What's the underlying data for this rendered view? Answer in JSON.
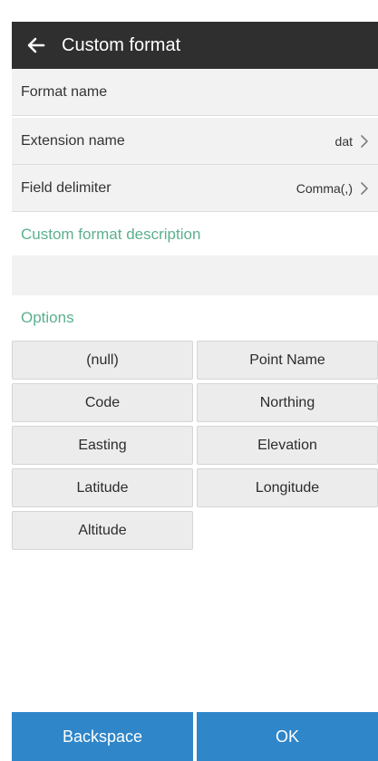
{
  "header": {
    "title": "Custom format"
  },
  "rows": [
    {
      "label": "Format name",
      "value": ""
    },
    {
      "label": "Extension name",
      "value": "dat"
    },
    {
      "label": "Field delimiter",
      "value": "Comma(,)"
    }
  ],
  "sections": {
    "description_title": "Custom format description",
    "options_title": "Options"
  },
  "options": [
    "(null)",
    "Point Name",
    "Code",
    "Northing",
    "Easting",
    "Elevation",
    "Latitude",
    "Longitude",
    "Altitude"
  ],
  "buttons": {
    "backspace": "Backspace",
    "ok": "OK"
  },
  "colors": {
    "header_bg": "#2f2f2f",
    "accent_green": "#5bb08e",
    "button_blue": "#2f86c9",
    "row_bg": "#f2f2f2"
  },
  "icons": {
    "back": "arrow-left-icon",
    "chevron": "chevron-right-icon"
  }
}
